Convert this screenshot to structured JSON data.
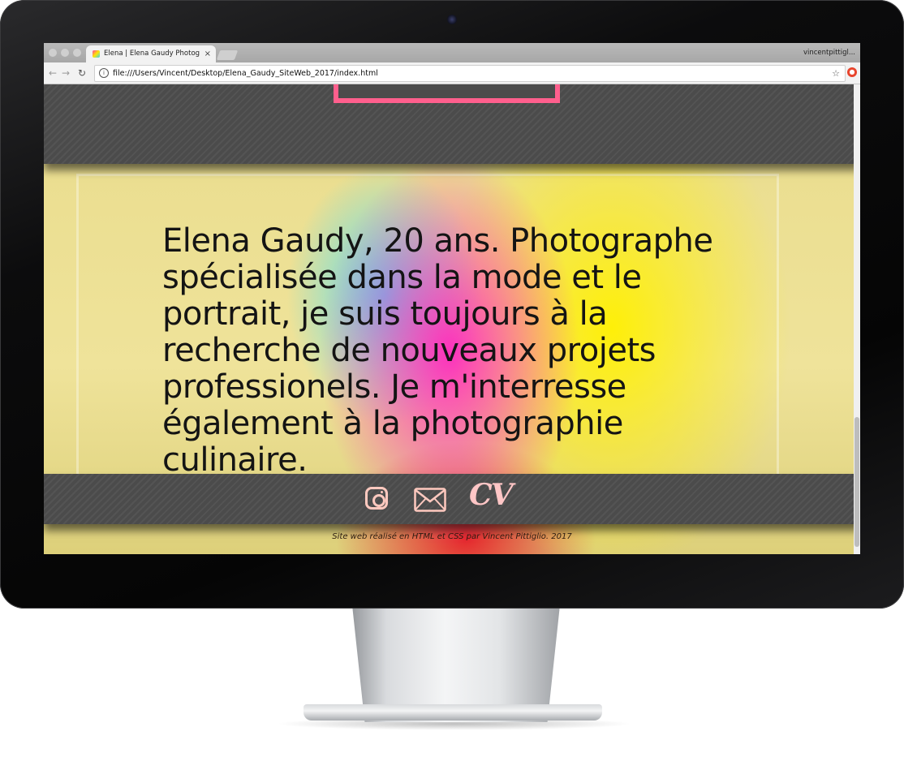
{
  "browser": {
    "tab_title": "Elena | Elena Gaudy Photograp",
    "tab_close": "×",
    "profile_name": "vincentpittigl...",
    "url": "file:///Users/Vincent/Desktop/Elena_Gaudy_SiteWeb_2017/index.html",
    "back_icon": "←",
    "forward_icon": "→",
    "reload_icon": "↻",
    "info_icon": "i",
    "bookmark_icon": "☆",
    "extension_icon": "●"
  },
  "page": {
    "bio": "Elena Gaudy, 20 ans. Photographe spécialisée dans la mode et le portrait, je suis toujours à la recherche de nouveaux projets professionels. Je m'interresse également à la photographie culinaire.",
    "social": {
      "instagram_icon": "instagram-icon",
      "mail_icon": "mail-icon",
      "cv_label": "CV"
    },
    "footer": "Site web réalisé en HTML et CSS par Vincent Pittiglio. 2017"
  },
  "colors": {
    "accent_pink": "#ff5f8d",
    "band_gray": "#4b4b4b",
    "icon_pink": "#ffc9bf"
  }
}
